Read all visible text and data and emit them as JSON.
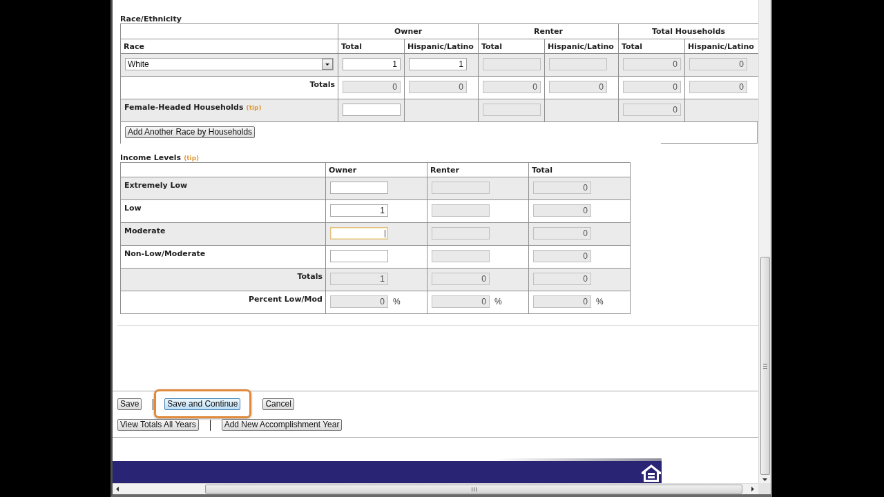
{
  "race_ethnicity": {
    "title": "Race/Ethnicity",
    "groups": [
      "Owner",
      "Renter",
      "Total Households"
    ],
    "label_column": "Race",
    "columns": [
      "Total",
      "Hispanic/Latino",
      "Total",
      "Hispanic/Latino",
      "Total",
      "Hispanic/Latino"
    ],
    "rows": [
      {
        "kind": "entry",
        "select": {
          "value": "White"
        },
        "cells": [
          {
            "kind": "input",
            "value": "1",
            "disabled": false
          },
          {
            "kind": "input",
            "value": "1",
            "disabled": false
          },
          {
            "kind": "input",
            "disabled": true
          },
          {
            "kind": "input",
            "disabled": true
          },
          {
            "kind": "input",
            "value": "0",
            "disabled": true
          },
          {
            "kind": "input",
            "value": "0",
            "disabled": true
          }
        ]
      },
      {
        "kind": "summary",
        "label": "Totals",
        "cells": [
          {
            "kind": "input",
            "value": "0",
            "disabled": true
          },
          {
            "kind": "input",
            "value": "0",
            "disabled": true
          },
          {
            "kind": "input",
            "value": "0",
            "disabled": true
          },
          {
            "kind": "input",
            "value": "0",
            "disabled": true
          },
          {
            "kind": "input",
            "value": "0",
            "disabled": true
          },
          {
            "kind": "input",
            "value": "0",
            "disabled": true
          }
        ]
      },
      {
        "kind": "label",
        "label": "Female-Headed Households",
        "tip": "(tip)",
        "cells": [
          {
            "kind": "input",
            "disabled": false
          },
          {
            "kind": "blank"
          },
          {
            "kind": "input",
            "disabled": true
          },
          {
            "kind": "blank"
          },
          {
            "kind": "input",
            "value": "0",
            "disabled": true
          },
          {
            "kind": "blank"
          }
        ]
      }
    ],
    "add_button": "Add Another Race by Households"
  },
  "income_levels": {
    "title": "Income Levels",
    "tip": "(tip)",
    "columns": [
      "Owner",
      "Renter",
      "Total"
    ],
    "rows": [
      {
        "kind": "label",
        "label": "Extremely Low",
        "cells": [
          {
            "kind": "input",
            "disabled": false,
            "focused": false
          },
          {
            "kind": "input",
            "disabled": true,
            "focused": false
          },
          {
            "kind": "input",
            "value": "0",
            "disabled": true,
            "focused": false
          }
        ]
      },
      {
        "kind": "label",
        "label": "Low",
        "cells": [
          {
            "kind": "input",
            "value": "1",
            "disabled": false,
            "focused": false
          },
          {
            "kind": "input",
            "disabled": true,
            "focused": false
          },
          {
            "kind": "input",
            "value": "0",
            "disabled": true,
            "focused": false
          }
        ]
      },
      {
        "kind": "label",
        "label": "Moderate",
        "cells": [
          {
            "kind": "input",
            "disabled": false,
            "focused": true
          },
          {
            "kind": "input",
            "disabled": true,
            "focused": false
          },
          {
            "kind": "input",
            "value": "0",
            "disabled": true,
            "focused": false
          }
        ]
      },
      {
        "kind": "label",
        "label": "Non-Low/Moderate",
        "cells": [
          {
            "kind": "input",
            "disabled": false,
            "focused": false
          },
          {
            "kind": "input",
            "disabled": true,
            "focused": false
          },
          {
            "kind": "input",
            "value": "0",
            "disabled": true,
            "focused": false
          }
        ]
      },
      {
        "kind": "summary",
        "label": "Totals",
        "cells": [
          {
            "kind": "input",
            "value": "1",
            "disabled": true,
            "focused": false
          },
          {
            "kind": "input",
            "value": "0",
            "disabled": true,
            "focused": false
          },
          {
            "kind": "input",
            "value": "0",
            "disabled": true,
            "focused": false
          }
        ]
      },
      {
        "kind": "summary",
        "label": "Percent Low/Mod",
        "cells": [
          {
            "kind": "input",
            "value": "0",
            "unit": "%",
            "disabled": true,
            "focused": false
          },
          {
            "kind": "input",
            "value": "0",
            "unit": "%",
            "disabled": true,
            "focused": false
          },
          {
            "kind": "input",
            "value": "0",
            "unit": "%",
            "disabled": true,
            "focused": false
          }
        ]
      }
    ]
  },
  "actions": [
    [
      {
        "kind": "button",
        "label": "Save",
        "highlighted": false
      },
      {
        "kind": "separator"
      },
      {
        "kind": "button",
        "label": "Save and Continue",
        "highlighted": true
      },
      {
        "kind": "button",
        "label": "Cancel",
        "highlighted": false
      }
    ],
    [
      {
        "kind": "button",
        "label": "View Totals All Years",
        "highlighted": false
      },
      {
        "kind": "separator"
      },
      {
        "kind": "button",
        "label": "Add New Accomplishment Year",
        "highlighted": false
      }
    ]
  ]
}
